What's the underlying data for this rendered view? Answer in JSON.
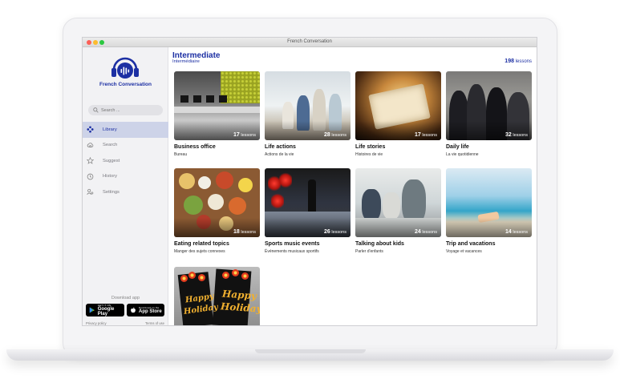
{
  "window": {
    "title": "French Conversation"
  },
  "sidebar": {
    "brand": "French Conversation",
    "search_placeholder": "Search ...",
    "items": [
      {
        "label": "Library",
        "icon": "library-icon",
        "active": true
      },
      {
        "label": "Search",
        "icon": "cloud-search-icon",
        "active": false
      },
      {
        "label": "Suggest",
        "icon": "star-icon",
        "active": false
      },
      {
        "label": "History",
        "icon": "history-icon",
        "active": false
      },
      {
        "label": "Settings",
        "icon": "settings-icon",
        "active": false
      }
    ],
    "download_label": "Download app",
    "google_play": {
      "small": "GET IT ON",
      "big": "Google Play"
    },
    "app_store": {
      "small": "Download on the",
      "big": "App Store"
    },
    "privacy": "Privacy policy",
    "terms": "Terms of use"
  },
  "main": {
    "title": "Intermediate",
    "subtitle": "Intermédiaire",
    "total_count": "198",
    "total_unit": "lessons",
    "cards": [
      {
        "title": "Business office",
        "subtitle": "Bureau",
        "count": "17",
        "unit": "lessons"
      },
      {
        "title": "Life actions",
        "subtitle": "Actions de la vie",
        "count": "28",
        "unit": "lessons"
      },
      {
        "title": "Life stories",
        "subtitle": "Histoires de vie",
        "count": "17",
        "unit": "lessons"
      },
      {
        "title": "Daily life",
        "subtitle": "La vie quotidienne",
        "count": "32",
        "unit": "lessons"
      },
      {
        "title": "Eating related topics",
        "subtitle": "Manger des sujets connexes",
        "count": "18",
        "unit": "lessons"
      },
      {
        "title": "Sports music events",
        "subtitle": "Événements musicaux sportifs",
        "count": "26",
        "unit": "lessons"
      },
      {
        "title": "Talking about kids",
        "subtitle": "Parler d'enfants",
        "count": "24",
        "unit": "lessons"
      },
      {
        "title": "Trip and vacations",
        "subtitle": "Voyage et vacances",
        "count": "14",
        "unit": "lessons"
      }
    ],
    "holiday_text": {
      "line1": "Happy",
      "line2": "Holiday"
    }
  },
  "colors": {
    "brand": "#1c2fa3",
    "active_bg": "#cdd3e8",
    "sidebar_bg": "#f2f2f4"
  }
}
